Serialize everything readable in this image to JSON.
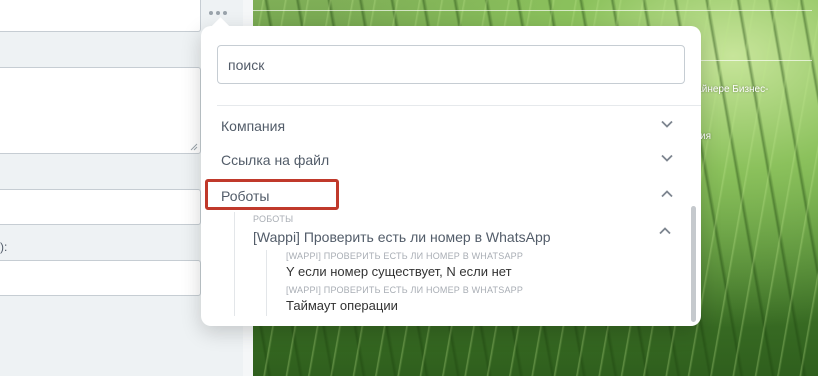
{
  "left_form": {
    "field_label_partial": "):"
  },
  "background": {
    "text_1": "изайнере Бизнес-",
    "text_2": "ия"
  },
  "popup": {
    "search": {
      "placeholder": "поиск",
      "value": ""
    },
    "sections": {
      "company": {
        "label": "Компания",
        "expanded": false
      },
      "file_link": {
        "label": "Ссылка на файл",
        "expanded": false
      },
      "robots": {
        "label": "Роботы",
        "expanded": true,
        "highlight_color": "#c0392b"
      }
    },
    "robots_group": {
      "caption": "РОБОТЫ",
      "title": "[Wappi] Проверить есть ли номер в WhatsApp",
      "expanded": true,
      "items": [
        {
          "caption": "[WAPPI] ПРОВЕРИТЬ ЕСТЬ ЛИ НОМЕР В WHATSAPP",
          "label": "Y если номер существует, N если нет"
        },
        {
          "caption": "[WAPPI] ПРОВЕРИТЬ ЕСТЬ ЛИ НОМЕР В WHATSAPP",
          "label": "Таймаут операции"
        }
      ]
    }
  },
  "icons": {
    "more": "more-dots-icon",
    "collapsed": "chevron-down-icon",
    "expanded": "chevron-up-icon"
  },
  "colors": {
    "text_primary": "#525c69",
    "caption": "#a8adb4",
    "highlight": "#c0392b"
  }
}
